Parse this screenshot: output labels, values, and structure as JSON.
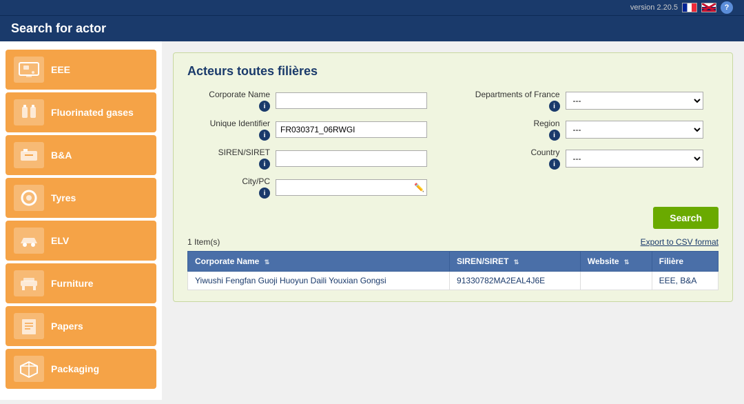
{
  "topbar": {
    "title": "Search for actor",
    "version": "version 2.20.5"
  },
  "sidebar": {
    "items": [
      {
        "id": "eee",
        "label": "EEE",
        "icon": "🖨"
      },
      {
        "id": "fluorinated-gases",
        "label": "Fluorinated gases",
        "icon": "🔧"
      },
      {
        "id": "ba",
        "label": "B&A",
        "icon": "🔋"
      },
      {
        "id": "tyres",
        "label": "Tyres",
        "icon": "⭕"
      },
      {
        "id": "elv",
        "label": "ELV",
        "icon": "🚗"
      },
      {
        "id": "furniture",
        "label": "Furniture",
        "icon": "🛋"
      },
      {
        "id": "papers",
        "label": "Papers",
        "icon": "📄"
      },
      {
        "id": "packaging",
        "label": "Packaging",
        "icon": "📦"
      }
    ]
  },
  "panel": {
    "title": "Acteurs toutes filières",
    "form": {
      "corporate_name_label": "Corporate Name",
      "unique_identifier_label": "Unique Identifier",
      "unique_identifier_value": "FR030371_06RWGI",
      "siren_siret_label": "SIREN/SIRET",
      "city_pc_label": "City/PC",
      "departments_france_label": "Departments of France",
      "region_label": "Region",
      "country_label": "Country",
      "select_default": "---"
    },
    "search_button": "Search",
    "export_link": "Export to CSV format",
    "results_count": "1 Item(s)",
    "table": {
      "headers": [
        {
          "label": "Corporate Name",
          "sortable": true
        },
        {
          "label": "SIREN/SIRET",
          "sortable": true
        },
        {
          "label": "Website",
          "sortable": true
        },
        {
          "label": "Filière",
          "sortable": false
        }
      ],
      "rows": [
        {
          "corporate_name": "Yiwushi Fengfan Guoji Huoyun Daili Youxian Gongsi",
          "siren_siret": "91330782MA2EAL4J6E",
          "website": "",
          "filiere": "EEE, B&A"
        }
      ]
    }
  }
}
